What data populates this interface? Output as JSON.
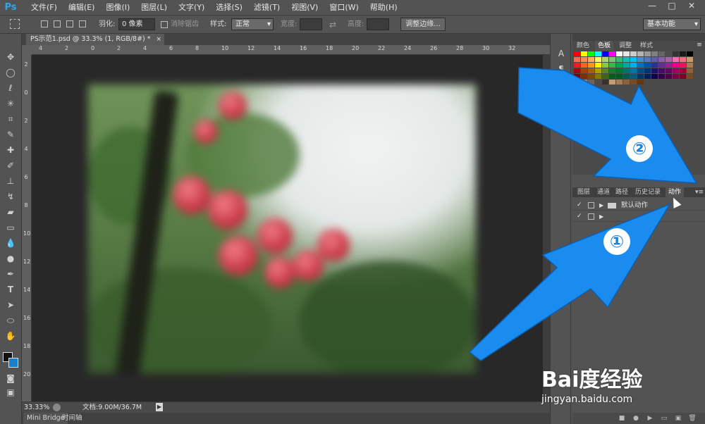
{
  "app": {
    "logo": "Ps",
    "menu": [
      "文件(F)",
      "编辑(E)",
      "图像(I)",
      "图层(L)",
      "文字(Y)",
      "选择(S)",
      "滤镜(T)",
      "视图(V)",
      "窗口(W)",
      "帮助(H)"
    ],
    "window_controls": {
      "minimize": "—",
      "maximize": "□",
      "close": "✕"
    }
  },
  "options": {
    "feather_label": "羽化:",
    "feather_value": "0 像素",
    "antialias_label": "消除锯齿",
    "style_label": "样式:",
    "style_value": "正常",
    "width_label": "宽度:",
    "height_label": "高度:",
    "refine_edge": "调整边缘...",
    "workspace": "基本功能"
  },
  "document": {
    "tab_title": "PS示范1.psd @ 33.3% (1, RGB/8#) *",
    "tab_close": "×",
    "zoom": "33.33%",
    "doc_info": "文档:9.00M/36.7M"
  },
  "rulers": {
    "h_ticks": [
      "4",
      "2",
      "0",
      "2",
      "4",
      "6",
      "8",
      "10",
      "12",
      "14",
      "16",
      "18",
      "20",
      "22",
      "24",
      "26",
      "28",
      "30",
      "32"
    ],
    "v_ticks": [
      "2",
      "0",
      "2",
      "4",
      "6",
      "8",
      "10",
      "12",
      "14",
      "16",
      "18",
      "20"
    ]
  },
  "bottom_tabs": [
    "Mini Bridge",
    "时间轴"
  ],
  "color_panel": {
    "tabs": [
      "颜色",
      "色板",
      "调整",
      "样式"
    ],
    "active_tab": "色板"
  },
  "layers_panel": {
    "tabs": [
      "图层",
      "通道",
      "路径",
      "历史记录",
      "动作"
    ],
    "active_tab": "动作",
    "actions": [
      {
        "label": "默认动作"
      },
      {
        "label": ""
      }
    ]
  },
  "annotations": {
    "badge_1": "①",
    "badge_2": "②",
    "arrow_color": "#1a8cf0"
  },
  "watermark": {
    "logo": "Bai度经验",
    "url": "jingyan.baidu.com"
  },
  "colors": {
    "ui_bg": "#535353",
    "canvas_bg": "#282828",
    "foreground": "#111111",
    "background": "#1a7fcb"
  }
}
